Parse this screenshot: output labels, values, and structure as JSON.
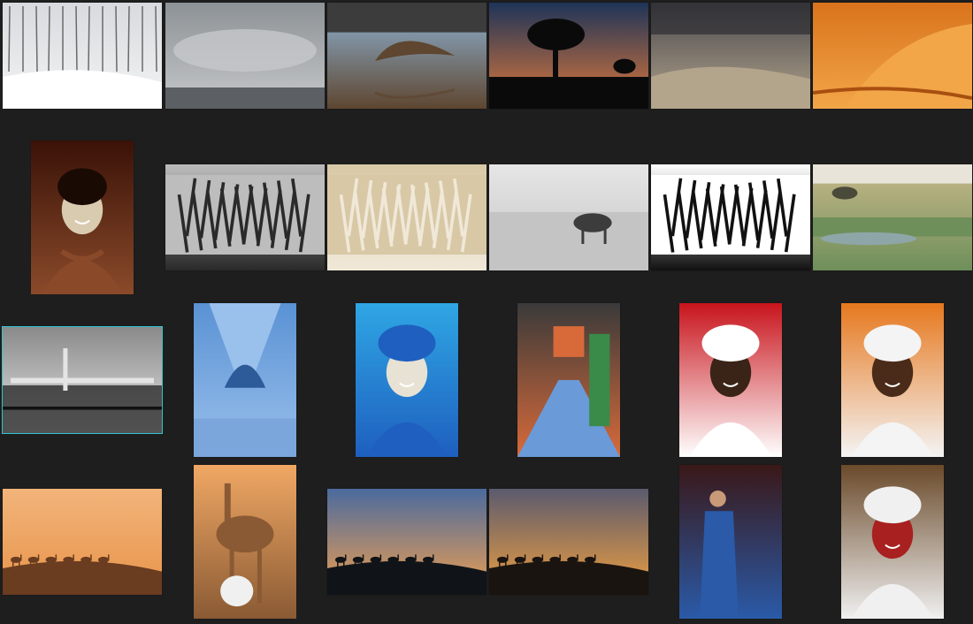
{
  "grid": {
    "background": "#1e1e1e",
    "selection_color": "#2ec4d0",
    "selected_photo": "tower-coast-photo"
  },
  "rows": [
    {
      "name": "row-1",
      "photos": [
        {
          "name": "snowy-forest-photo",
          "orientation": "landscape",
          "palette": [
            "#d8dade",
            "#f4f4f4",
            "#6a6a6a"
          ],
          "subject": "snow"
        },
        {
          "name": "misty-clouds-photo",
          "orientation": "landscape",
          "palette": [
            "#8d9296",
            "#c6c8ca",
            "#5c6064"
          ],
          "subject": "mist"
        },
        {
          "name": "eagle-over-water-photo",
          "orientation": "landscape",
          "palette": [
            "#8fb4d6",
            "#5e4630",
            "#3c3c3c"
          ],
          "subject": "bird"
        },
        {
          "name": "quiver-tree-sunset-photo",
          "orientation": "landscape",
          "palette": [
            "#1e3458",
            "#e0793a",
            "#0a0a0a"
          ],
          "subject": "tree"
        },
        {
          "name": "stormy-dunes-photo",
          "orientation": "landscape",
          "palette": [
            "#4a4a4e",
            "#b3a48c",
            "#24242a"
          ],
          "subject": "dunes"
        },
        {
          "name": "orange-sand-ridge-photo",
          "orientation": "landscape",
          "palette": [
            "#d9731c",
            "#f2a648",
            "#a84f10"
          ],
          "subject": "sand"
        }
      ]
    },
    {
      "name": "row-2",
      "photos": [
        {
          "name": "smiling-woman-portrait-photo",
          "orientation": "portrait",
          "palette": [
            "#3a1208",
            "#8a4a2a",
            "#d9cbb0"
          ],
          "subject": "portrait"
        },
        {
          "name": "zebras-drinking-photo",
          "orientation": "landscape",
          "palette": [
            "#bdbdbd",
            "#2a2a2a",
            "#e8e8e8"
          ],
          "subject": "zebra"
        },
        {
          "name": "zebras-dry-grass-photo",
          "orientation": "landscape",
          "palette": [
            "#d8c8a6",
            "#f0e8d8",
            "#3a3020"
          ],
          "subject": "zebra"
        },
        {
          "name": "wildebeest-plain-photo",
          "orientation": "landscape",
          "palette": [
            "#e6e6e6",
            "#c4c4c4",
            "#3c3c3c"
          ],
          "subject": "animal"
        },
        {
          "name": "zebra-closeup-photo",
          "orientation": "landscape",
          "palette": [
            "#ffffff",
            "#111111",
            "#d4d4d4"
          ],
          "subject": "zebra"
        },
        {
          "name": "savanna-waterhole-photo",
          "orientation": "landscape",
          "palette": [
            "#c8b88a",
            "#6e8f5a",
            "#8fa6a8"
          ],
          "subject": "savanna"
        }
      ]
    },
    {
      "name": "row-3",
      "photos": [
        {
          "name": "tower-coast-photo",
          "orientation": "landscape",
          "palette": [
            "#8a8a8a",
            "#e4e4e4",
            "#2c2c2c"
          ],
          "subject": "coast"
        },
        {
          "name": "blue-alley-photo",
          "orientation": "portrait",
          "palette": [
            "#5a92d4",
            "#9ac0ec",
            "#2d5a98"
          ],
          "subject": "alley"
        },
        {
          "name": "blue-turban-man-photo",
          "orientation": "portrait",
          "palette": [
            "#2fa6e4",
            "#1e5fbf",
            "#e8e2d4"
          ],
          "subject": "turban"
        },
        {
          "name": "colorful-market-lane-photo",
          "orientation": "portrait",
          "palette": [
            "#3a3a3a",
            "#d86a3a",
            "#6a9ad8"
          ],
          "subject": "lane"
        },
        {
          "name": "red-backdrop-portrait-photo",
          "orientation": "portrait",
          "palette": [
            "#c8141c",
            "#ffffff",
            "#3a2418"
          ],
          "subject": "turban"
        },
        {
          "name": "orange-backdrop-portrait-photo",
          "orientation": "portrait",
          "palette": [
            "#e6781e",
            "#f4f4f4",
            "#4a2a18"
          ],
          "subject": "turban"
        }
      ]
    },
    {
      "name": "row-4",
      "photos": [
        {
          "name": "camel-caravan-desert-photo",
          "orientation": "landscape",
          "palette": [
            "#f2b47a",
            "#e8944a",
            "#6a3c20"
          ],
          "subject": "caravan"
        },
        {
          "name": "camel-rider-resting-photo",
          "orientation": "portrait",
          "palette": [
            "#f0a864",
            "#8a5a34",
            "#f0f0f0"
          ],
          "subject": "camel"
        },
        {
          "name": "caravan-blue-sky-photo",
          "orientation": "landscape",
          "palette": [
            "#4a6a9e",
            "#f0a050",
            "#101418"
          ],
          "subject": "caravan"
        },
        {
          "name": "caravan-sunset-photo",
          "orientation": "landscape",
          "palette": [
            "#5a5a6e",
            "#f0a040",
            "#1a1410"
          ],
          "subject": "caravan"
        },
        {
          "name": "man-in-blue-robe-photo",
          "orientation": "portrait",
          "palette": [
            "#3a1818",
            "#2a5aa8",
            "#c89a78"
          ],
          "subject": "standing"
        },
        {
          "name": "elder-white-turban-photo",
          "orientation": "portrait",
          "palette": [
            "#6a4a2a",
            "#f0f0f0",
            "#a82020"
          ],
          "subject": "turban"
        }
      ]
    }
  ]
}
